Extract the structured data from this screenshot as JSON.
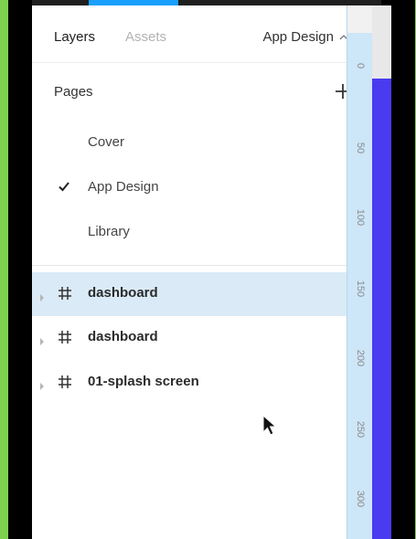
{
  "header": {
    "tabs": [
      {
        "label": "Layers",
        "active": true
      },
      {
        "label": "Assets",
        "active": false
      }
    ],
    "current_page": "App Design",
    "current_page_icon": "chevron-up-icon"
  },
  "pages": {
    "title": "Pages",
    "add_icon": "plus-icon",
    "items": [
      {
        "label": "Cover",
        "selected": false
      },
      {
        "label": "App Design",
        "selected": true
      },
      {
        "label": "Library",
        "selected": false
      }
    ]
  },
  "layers": {
    "items": [
      {
        "label": "dashboard",
        "icon": "frame-hash-icon",
        "selected": true
      },
      {
        "label": "dashboard",
        "icon": "frame-hash-icon",
        "selected": false
      },
      {
        "label": "01-splash screen",
        "icon": "frame-hash-icon",
        "selected": false
      }
    ]
  },
  "ruler": {
    "ticks": [
      "0",
      "50",
      "100",
      "150",
      "200",
      "250",
      "300"
    ]
  },
  "colors": {
    "accent": "#18a0fb",
    "selection": "#daebf7",
    "ruler": "#cde6f8",
    "frame_fill": "#4a3af0",
    "background_border": "#7fd14f"
  }
}
